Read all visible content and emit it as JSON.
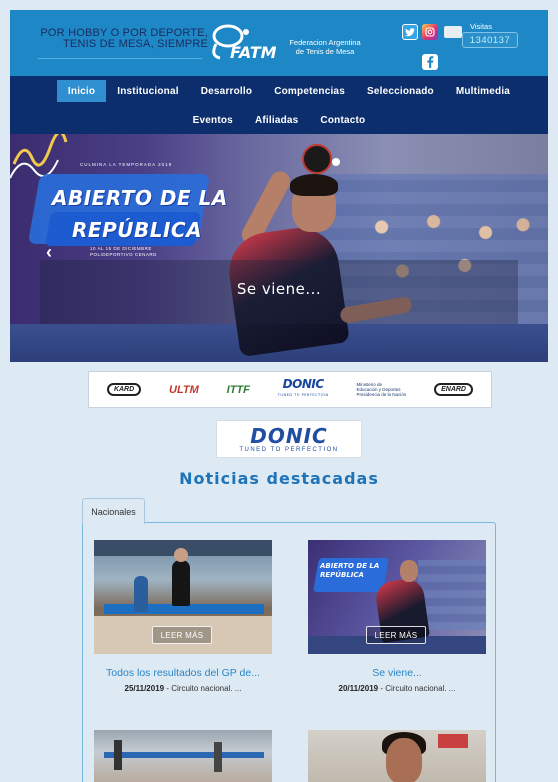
{
  "header": {
    "slogan_line1": "POR HOBBY O POR DEPORTE,",
    "slogan_line2": "TENIS DE MESA, SIEMPRE",
    "logo_acronym": "FATM",
    "logo_name_line1": "Federacion Argentina",
    "logo_name_line2": "de Tenis de Mesa",
    "visits_label": "Visitas",
    "visits_count": "1340137",
    "social_icons": [
      "twitter-icon",
      "instagram-icon",
      "facebook-icon"
    ],
    "brand_color": "#1e88c7"
  },
  "nav": {
    "row1": [
      "Inicio",
      "Institucional",
      "Desarrollo",
      "Competencias",
      "Seleccionado",
      "Multimedia"
    ],
    "row2": [
      "Eventos",
      "Afiliadas",
      "Contacto"
    ],
    "active": "Inicio",
    "background": "#0d2e6d",
    "active_color": "#2f8fd0"
  },
  "hero": {
    "eyebrow": "CULMINA LA TEMPORADA 2019",
    "title_line1": "ABIERTO DE LA",
    "title_line2": "REPÚBLICA",
    "dates_line1": "10 AL 15 DE DICIEMBRE",
    "dates_line2": "POLIDEPORTIVO CENARD",
    "caption": "Se viene...",
    "prev_arrow": "‹"
  },
  "sponsors": {
    "kard": "KARD",
    "ultm": "ULTM",
    "ittf": "ITTF",
    "donic": "DONIC",
    "donic_tag": "TUNED TO PERFECTION",
    "ministry_line1": "Ministerio de",
    "ministry_line2": "Educación y Deportes",
    "ministry_line3": "Presidencia de la Nación",
    "enard": "ENARD"
  },
  "donic_banner": {
    "word": "DONIC",
    "tagline": "TUNED TO PERFECTION"
  },
  "news": {
    "section_title": "Noticias destacadas",
    "tab_label": "Nacionales",
    "more_label": "LEER MÁS",
    "items": [
      {
        "title": "Todos los resultados del GP de...",
        "date": "25/11/2019",
        "category": " - Circuito nacional. ..."
      },
      {
        "title": "Se viene...",
        "date": "20/11/2019",
        "category": " - Circuito nacional. ..."
      }
    ]
  }
}
